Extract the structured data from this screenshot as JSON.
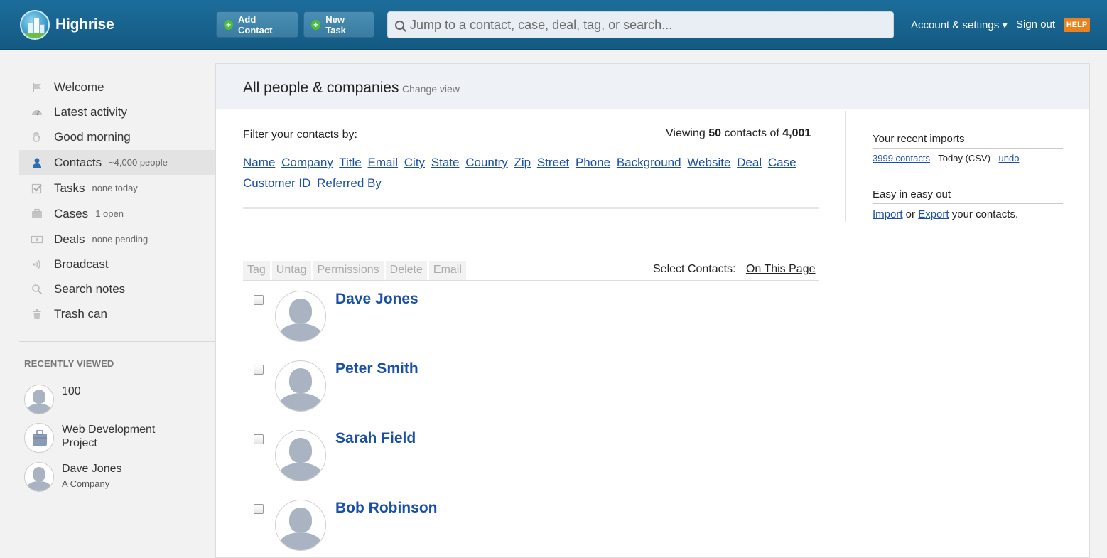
{
  "header": {
    "app_name": "Highrise",
    "add_contact_label": "Add Contact",
    "new_task_label": "New Task",
    "search_placeholder": "Jump to a contact, case, deal, tag, or search...",
    "account_label": "Account & settings ▾",
    "sign_out_label": "Sign out",
    "help_label": "HELP"
  },
  "sidebar": {
    "items": [
      {
        "label": "Welcome",
        "sub": "",
        "icon": "flag-icon"
      },
      {
        "label": "Latest activity",
        "sub": "",
        "icon": "gauge-icon"
      },
      {
        "label": "Good morning",
        "sub": "",
        "icon": "hand-icon"
      },
      {
        "label": "Contacts",
        "sub": "~4,000 people",
        "icon": "person-icon",
        "active": true
      },
      {
        "label": "Tasks",
        "sub": "none today",
        "icon": "checkbox-icon"
      },
      {
        "label": "Cases",
        "sub": "1 open",
        "icon": "briefcase-icon"
      },
      {
        "label": "Deals",
        "sub": "none pending",
        "icon": "money-icon"
      },
      {
        "label": "Broadcast",
        "sub": "",
        "icon": "broadcast-icon"
      },
      {
        "label": "Search notes",
        "sub": "",
        "icon": "search-icon"
      },
      {
        "label": "Trash can",
        "sub": "",
        "icon": "trash-icon"
      }
    ],
    "recently_viewed_heading": "RECENTLY VIEWED",
    "recent": [
      {
        "title": "100",
        "sub": ""
      },
      {
        "title": "Web Development Project",
        "sub": ""
      },
      {
        "title": "Dave Jones",
        "sub": "A Company"
      }
    ]
  },
  "main": {
    "title": "All people & companies",
    "change_view": "Change view",
    "filter_label": "Filter your contacts by:",
    "viewing_prefix": "Viewing",
    "viewing_count": "50",
    "viewing_mid": "contacts of",
    "viewing_total": "4,001",
    "filters": [
      "Name",
      "Company",
      "Title",
      "Email",
      "City",
      "State",
      "Country",
      "Zip",
      "Street",
      "Phone",
      "Background",
      "Website",
      "Deal",
      "Case",
      "Customer ID",
      "Referred By"
    ],
    "actions": [
      "Tag",
      "Untag",
      "Permissions",
      "Delete",
      "Email"
    ],
    "select_contacts_label": "Select Contacts:",
    "on_this_page": "On This Page",
    "contacts": [
      "Dave Jones",
      "Peter Smith",
      "Sarah Field",
      "Bob Robinson"
    ]
  },
  "right": {
    "imports_heading": "Your recent imports",
    "imports_link": "3999 contacts",
    "imports_meta": " - Today (CSV) - ",
    "imports_undo": "undo",
    "easy_heading": "Easy in easy out",
    "import_link": "Import",
    "or_text": " or ",
    "export_link": "Export",
    "export_suffix": " your contacts."
  }
}
